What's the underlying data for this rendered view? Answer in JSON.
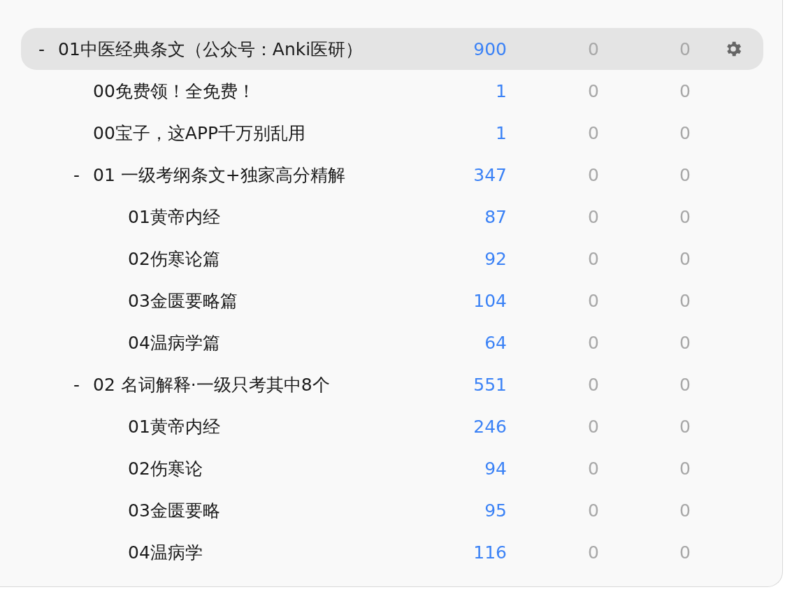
{
  "decks": [
    {
      "name": "01中医经典条文（公众号：Anki医研）",
      "toggle": "-",
      "selected": true,
      "new": "900",
      "learn": "0",
      "due": "0",
      "children": [
        {
          "name": "00免费领！全免费！",
          "selected": false,
          "new": "1",
          "learn": "0",
          "due": "0"
        },
        {
          "name": "00宝子，这APP千万别乱用",
          "selected": false,
          "new": "1",
          "learn": "0",
          "due": "0"
        },
        {
          "name": "01 一级考纲条文+独家高分精解",
          "toggle": "-",
          "selected": false,
          "new": "347",
          "learn": "0",
          "due": "0",
          "children": [
            {
              "name": "01黄帝内经",
              "selected": false,
              "new": "87",
              "learn": "0",
              "due": "0"
            },
            {
              "name": "02伤寒论篇",
              "selected": false,
              "new": "92",
              "learn": "0",
              "due": "0"
            },
            {
              "name": "03金匮要略篇",
              "selected": false,
              "new": "104",
              "learn": "0",
              "due": "0"
            },
            {
              "name": "04温病学篇",
              "selected": false,
              "new": "64",
              "learn": "0",
              "due": "0"
            }
          ]
        },
        {
          "name": "02 名词解释·一级只考其中8个",
          "toggle": "-",
          "selected": false,
          "new": "551",
          "learn": "0",
          "due": "0",
          "children": [
            {
              "name": "01黄帝内经",
              "selected": false,
              "new": "246",
              "learn": "0",
              "due": "0"
            },
            {
              "name": "02伤寒论",
              "selected": false,
              "new": "94",
              "learn": "0",
              "due": "0"
            },
            {
              "name": "03金匮要略",
              "selected": false,
              "new": "95",
              "learn": "0",
              "due": "0"
            },
            {
              "name": "04温病学",
              "selected": false,
              "new": "116",
              "learn": "0",
              "due": "0"
            }
          ]
        }
      ]
    }
  ]
}
